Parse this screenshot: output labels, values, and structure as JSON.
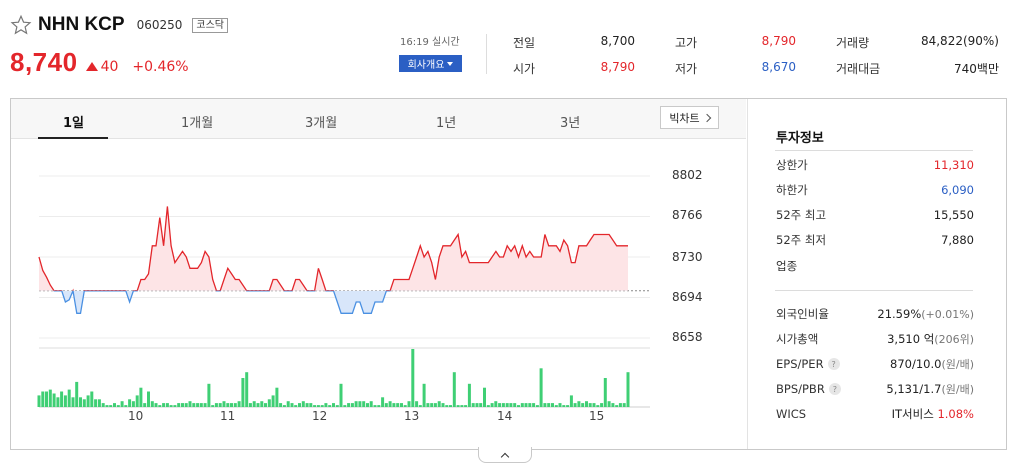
{
  "stock": {
    "name": "NHN KCP",
    "code": "060250",
    "market": "코스닥",
    "price": "8,740",
    "change": "40",
    "change_rate": "+0.46%"
  },
  "header": {
    "realtime": "16:19 실시간",
    "company_button": "회사개요"
  },
  "stats": {
    "prev_close": {
      "label": "전일",
      "value": "8,700"
    },
    "open": {
      "label": "시가",
      "value": "8,790"
    },
    "high": {
      "label": "고가",
      "value": "8,790"
    },
    "low": {
      "label": "저가",
      "value": "8,670"
    },
    "volume": {
      "label": "거래량",
      "value": "84,822(90%)"
    },
    "amount": {
      "label": "거래대금",
      "value": "740백만"
    }
  },
  "tabs": [
    "1일",
    "1개월",
    "3개월",
    "1년",
    "3년"
  ],
  "active_tab": "1일",
  "big_chart_label": "빅차트",
  "info": {
    "title": "투자정보",
    "upper_limit": {
      "label": "상한가",
      "value": "11,310"
    },
    "lower_limit": {
      "label": "하한가",
      "value": "6,090"
    },
    "high52": {
      "label": "52주 최고",
      "value": "15,550"
    },
    "low52": {
      "label": "52주 최저",
      "value": "7,880"
    },
    "industry": {
      "label": "업종"
    },
    "foreign": {
      "label": "외국인비율",
      "value": "21.59%",
      "extra": "(+0.01%)"
    },
    "marketcap": {
      "label": "시가총액",
      "value": "3,510",
      "unit": "억",
      "extra": "(206위)"
    },
    "eps": {
      "label": "EPS/PER",
      "value": "870/10.0",
      "extra": "(원/배)"
    },
    "bps": {
      "label": "BPS/PBR",
      "value": "5,131/1.7",
      "extra": "(원/배)"
    },
    "wics": {
      "label": "WICS",
      "value": "IT서비스",
      "extra": "1.08%"
    }
  },
  "colors": {
    "up": "#e3262b",
    "down": "#2b5fc4",
    "volume_bar": "#3fcf74",
    "area_up": "#fde4e6",
    "area_down": "#d8e6fa"
  },
  "chart_data": {
    "type": "line",
    "baseline": 8700,
    "ylim": [
      8640,
      8820
    ],
    "yticks": [
      8802,
      8766,
      8730,
      8694,
      8658
    ],
    "xticks": [
      "10",
      "11",
      "12",
      "13",
      "14",
      "15"
    ],
    "price": [
      8730,
      8718,
      8712,
      8705,
      8700,
      8700,
      8700,
      8690,
      8692,
      8700,
      8680,
      8680,
      8700,
      8700,
      8700,
      8700,
      8700,
      8700,
      8700,
      8700,
      8700,
      8700,
      8700,
      8700,
      8690,
      8700,
      8700,
      8710,
      8710,
      8715,
      8740,
      8740,
      8765,
      8740,
      8775,
      8740,
      8725,
      8730,
      8735,
      8730,
      8720,
      8720,
      8720,
      8725,
      8735,
      8730,
      8710,
      8700,
      8700,
      8710,
      8720,
      8715,
      8710,
      8710,
      8705,
      8700,
      8700,
      8700,
      8700,
      8700,
      8700,
      8700,
      8710,
      8710,
      8705,
      8700,
      8700,
      8700,
      8710,
      8710,
      8705,
      8700,
      8700,
      8700,
      8720,
      8710,
      8700,
      8700,
      8700,
      8690,
      8680,
      8680,
      8680,
      8680,
      8690,
      8690,
      8680,
      8680,
      8680,
      8690,
      8690,
      8690,
      8700,
      8700,
      8710,
      8710,
      8710,
      8710,
      8710,
      8720,
      8730,
      8740,
      8730,
      8735,
      8725,
      8710,
      8730,
      8740,
      8740,
      8740,
      8745,
      8750,
      8730,
      8735,
      8725,
      8725,
      8725,
      8725,
      8725,
      8725,
      8730,
      8735,
      8730,
      8730,
      8740,
      8735,
      8740,
      8730,
      8740,
      8730,
      8735,
      8730,
      8730,
      8730,
      8750,
      8740,
      8740,
      8740,
      8735,
      8745,
      8740,
      8725,
      8725,
      8740,
      8740,
      8740,
      8745,
      8750,
      8750,
      8750,
      8750,
      8750,
      8745,
      8740,
      8740,
      8740,
      8740
    ],
    "volume": [
      6,
      8,
      8,
      9,
      7,
      5,
      8,
      6,
      9,
      5,
      7,
      5,
      4,
      6,
      8,
      4,
      4,
      2,
      1,
      1,
      2,
      1,
      3,
      1,
      4,
      3,
      6,
      3,
      2,
      2,
      3,
      2,
      1,
      2,
      2,
      1,
      1,
      2,
      2,
      2,
      3,
      2,
      2,
      2,
      2,
      1,
      1,
      2,
      2,
      3,
      2,
      2,
      2,
      3,
      15,
      2,
      2,
      3,
      2,
      3,
      2,
      4,
      6,
      10,
      2,
      1,
      3,
      2,
      1,
      2,
      3,
      2,
      2,
      1,
      1,
      1,
      2,
      1,
      2,
      1,
      1,
      1,
      2,
      2,
      3,
      3,
      3,
      2,
      3,
      1,
      1,
      5,
      2,
      3,
      2,
      2,
      2,
      1,
      3,
      4,
      3,
      1,
      12,
      2,
      2,
      2,
      3,
      2,
      1,
      1,
      1,
      1,
      1,
      1,
      1,
      2,
      2,
      2,
      2,
      1,
      2,
      3,
      2,
      2,
      2,
      2,
      2,
      1,
      2,
      2,
      2,
      2,
      1,
      4,
      2,
      2,
      2,
      1,
      2,
      1,
      1,
      6,
      2,
      3,
      2,
      3,
      2,
      2,
      1,
      2,
      2,
      3,
      2,
      1,
      2,
      2,
      2,
      1,
      2,
      2,
      1
    ],
    "volume_spikes": {
      "10": 13,
      "27": 10,
      "29": 8,
      "45": 12,
      "55": 18,
      "80": 12,
      "99": 30,
      "110": 18,
      "114": 12,
      "118": 10,
      "133": 20,
      "150": 15,
      "156": 18
    }
  }
}
